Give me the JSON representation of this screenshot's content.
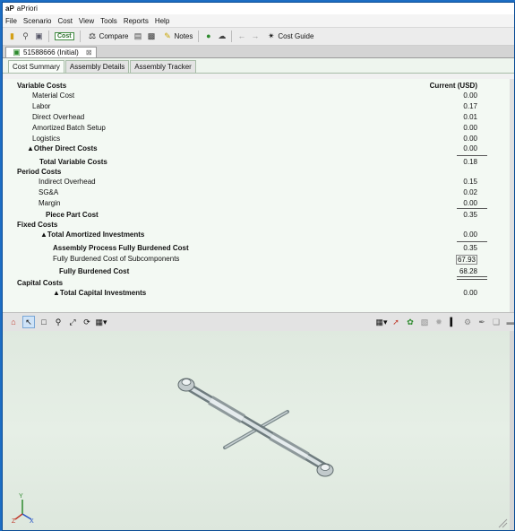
{
  "app": {
    "logo": "aP",
    "title": "aPriori"
  },
  "menu": [
    "File",
    "Scenario",
    "Cost",
    "View",
    "Tools",
    "Reports",
    "Help"
  ],
  "toolbar": {
    "cost_chip": "Cost",
    "compare_label": "Compare",
    "notes_label": "Notes",
    "cost_guide_label": "Cost Guide"
  },
  "doc_tab": {
    "label": "51588666 (Initial)",
    "close": "⊠"
  },
  "subtabs": [
    "Cost Summary",
    "Assembly Details",
    "Assembly Tracker"
  ],
  "summary": {
    "current_header": "Current (USD)",
    "variable_costs": "Variable Costs",
    "material_cost": {
      "label": "Material Cost",
      "value": "0.00"
    },
    "labor": {
      "label": "Labor",
      "value": "0.17"
    },
    "direct_overhead": {
      "label": "Direct Overhead",
      "value": "0.01"
    },
    "amortized_batch": {
      "label": "Amortized Batch Setup",
      "value": "0.00"
    },
    "logistics": {
      "label": "Logistics",
      "value": "0.00"
    },
    "other_direct": {
      "label": "Other Direct Costs",
      "value": "0.00"
    },
    "total_variable": {
      "label": "Total Variable Costs",
      "value": "0.18"
    },
    "period_costs": "Period Costs",
    "indirect_overhead": {
      "label": "Indirect Overhead",
      "value": "0.15"
    },
    "sga": {
      "label": "SG&A",
      "value": "0.02"
    },
    "margin": {
      "label": "Margin",
      "value": "0.00"
    },
    "piece_part": {
      "label": "Piece Part Cost",
      "value": "0.35"
    },
    "fixed_costs": "Fixed Costs",
    "total_amortized": {
      "label": "Total Amortized Investments",
      "value": "0.00"
    },
    "assembly_process": {
      "label": "Assembly Process Fully Burdened Cost",
      "value": "0.35"
    },
    "subcomponents": {
      "label": "Fully Burdened Cost of Subcomponents",
      "value": "67.93"
    },
    "fully_burdened": {
      "label": "Fully Burdened Cost",
      "value": "68.28"
    },
    "capital_costs": "Capital Costs",
    "total_capital": {
      "label": "Total Capital Investments",
      "value": "0.00"
    }
  },
  "axis": {
    "y": "Y",
    "z": "Z",
    "x": "X"
  },
  "colors": {
    "accent": "#1d6ec4",
    "pane_bg": "#f3f9f3"
  }
}
